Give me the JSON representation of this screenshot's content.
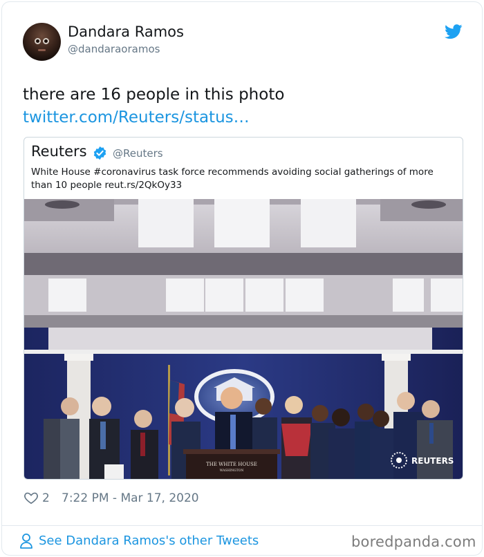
{
  "author": {
    "display_name": "Dandara Ramos",
    "handle": "@dandaraoramos",
    "avatar_icon": "avatar-portrait-icon"
  },
  "tweet": {
    "text": "there are 16 people in this photo",
    "link": "twitter.com/Reuters/status…"
  },
  "quoted": {
    "name": "Reuters",
    "handle": "@Reuters",
    "verified": true,
    "text": "White House #coronavirus task force recommends avoiding social gatherings of more than 10 people reut.rs/2QkOy33",
    "photo": {
      "podium_line1": "THE WHITE HOUSE",
      "podium_line2": "WASHINGTON",
      "credit": "REUTERS"
    }
  },
  "actions": {
    "like_count": "2",
    "timestamp": "7:22 PM - Mar 17, 2020"
  },
  "footer": {
    "see_more": "See Dandara Ramos's other Tweets",
    "watermark": "boredpanda.com"
  },
  "colors": {
    "link_blue": "#1b95e0",
    "secondary_gray": "#657786",
    "verified_blue": "#1da1f2",
    "backdrop_blue": "#1f2a66"
  }
}
